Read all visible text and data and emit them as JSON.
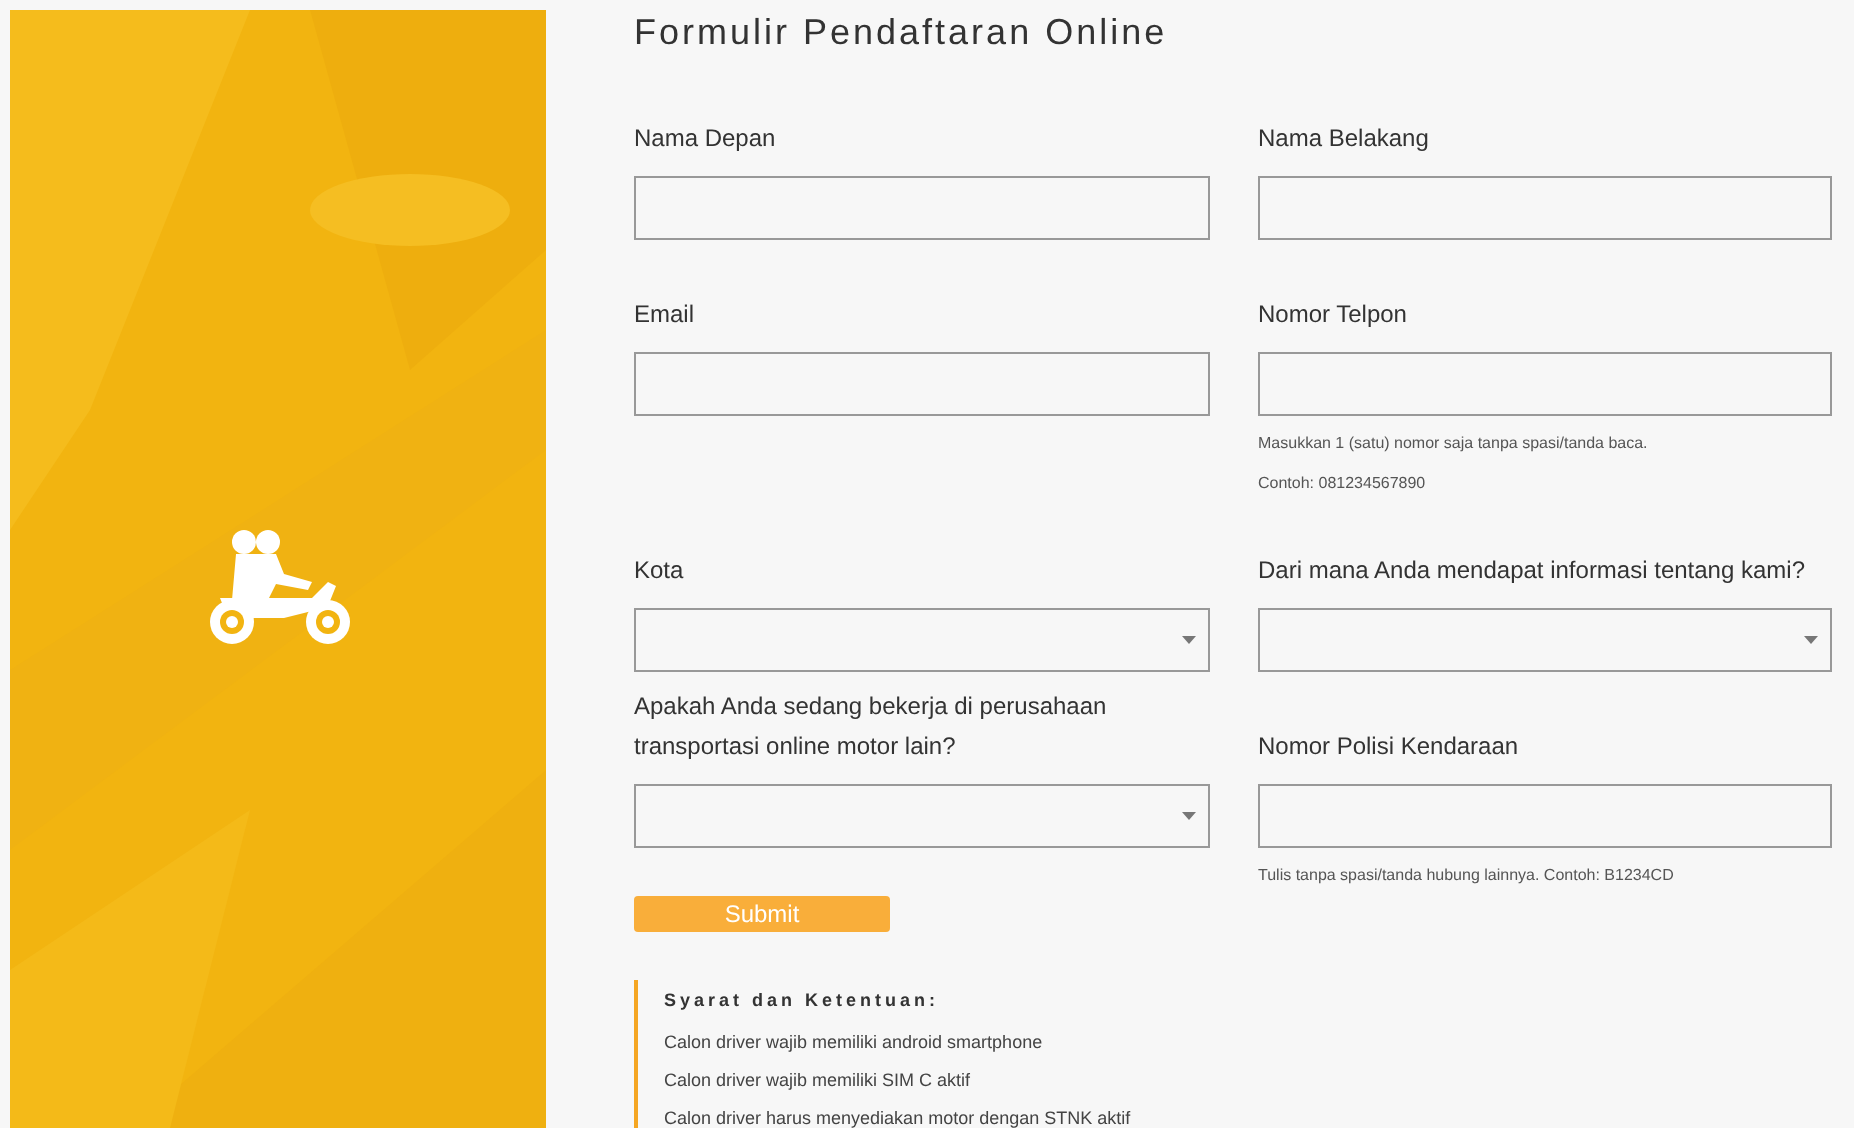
{
  "title": "Formulir Pendaftaran Online",
  "fields": [
    {
      "label": "Nama Depan",
      "kind": "text"
    },
    {
      "label": "Nama Belakang",
      "kind": "text"
    },
    {
      "label": "Email",
      "kind": "text"
    },
    {
      "label": "Nomor Telpon",
      "kind": "text",
      "hints": [
        "Masukkan 1 (satu) nomor saja tanpa spasi/tanda baca.",
        "Contoh: 081234567890"
      ]
    },
    {
      "label": "Kota",
      "kind": "select"
    },
    {
      "label": "Dari mana Anda mendapat informasi tentang kami?",
      "kind": "select"
    },
    {
      "label": "Apakah Anda sedang bekerja di perusahaan transportasi online motor lain?",
      "kind": "select"
    },
    {
      "label": "Nomor Polisi Kendaraan",
      "kind": "text",
      "hints": [
        "Tulis tanpa spasi/tanda hubung lainnya. Contoh: B1234CD"
      ]
    }
  ],
  "submit": "Submit",
  "terms": {
    "title": "Syarat dan Ketentuan:",
    "items": [
      "Calon driver wajib memiliki android smartphone",
      "Calon driver wajib memiliki SIM C aktif",
      "Calon driver harus menyediakan motor dengan STNK aktif"
    ]
  }
}
